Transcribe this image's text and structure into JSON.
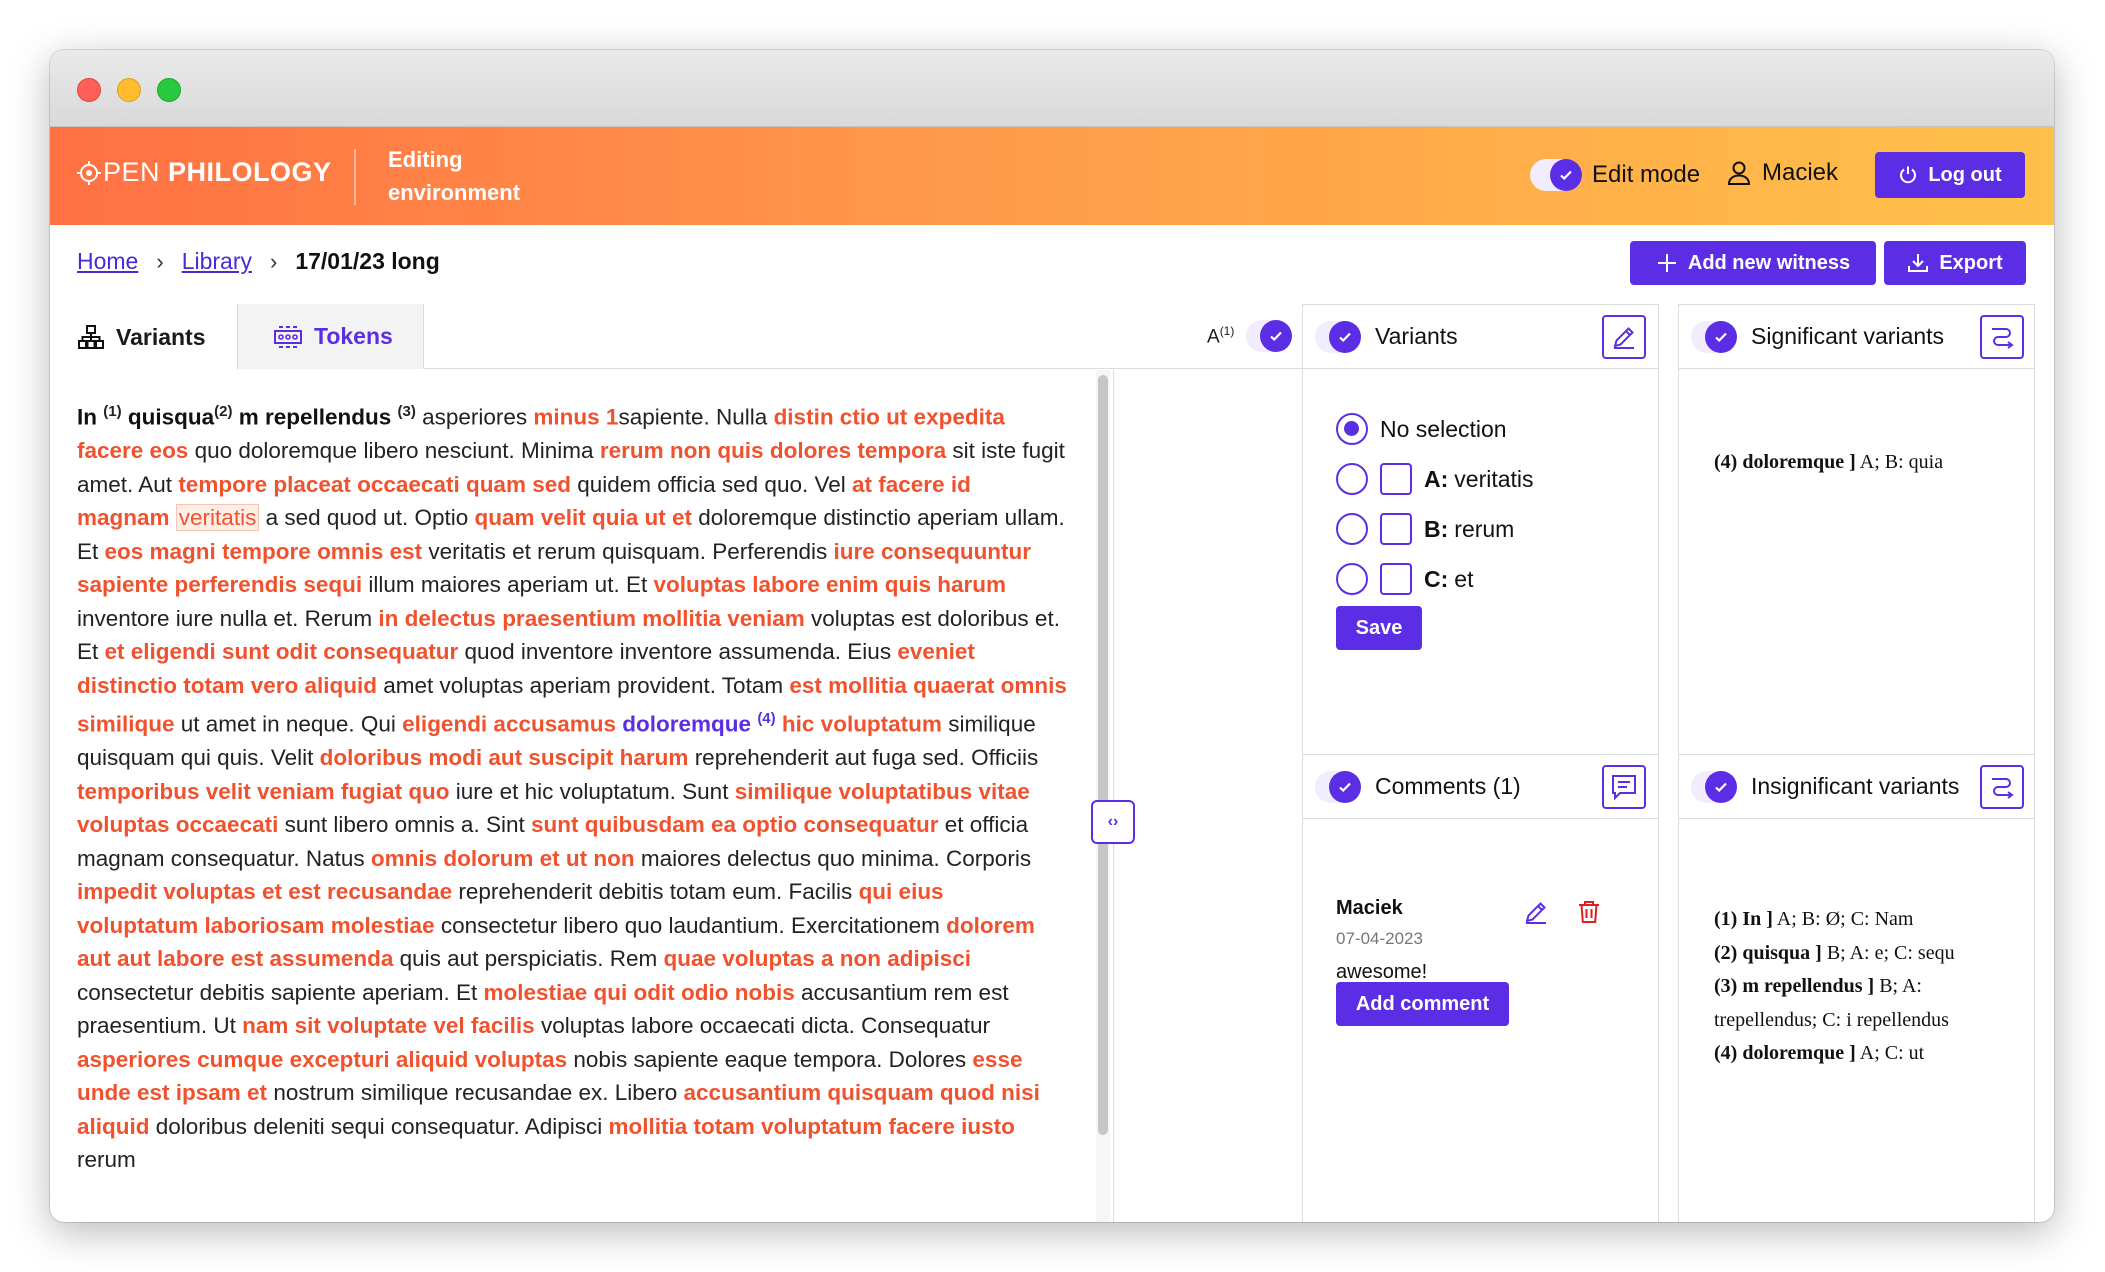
{
  "app": {
    "logo_left": "PEN",
    "logo_right": "PHILOLOGY",
    "environment_label": "Editing environment",
    "edit_mode_label": "Edit mode",
    "user_name": "Maciek",
    "logout_label": "Log out"
  },
  "breadcrumb": {
    "home": "Home",
    "library": "Library",
    "current": "17/01/23 long"
  },
  "actions": {
    "add_witness": "Add new witness",
    "export": "Export"
  },
  "tabs": {
    "variants": "Variants",
    "tokens": "Tokens",
    "witness_label": "A",
    "witness_sup": "(1)"
  },
  "text_segments": [
    {
      "t": "In ",
      "s": "b"
    },
    {
      "t": "(1)",
      "s": "supb"
    },
    {
      "t": " quisqua",
      "s": "b"
    },
    {
      "t": "(2)",
      "s": "supb"
    },
    {
      "t": " m repellendus ",
      "s": "b"
    },
    {
      "t": "(3)",
      "s": "supb"
    },
    {
      "t": " asperiores "
    },
    {
      "t": "minus 1",
      "s": "v"
    },
    {
      "t": "sapiente. Nulla "
    },
    {
      "t": "distin ctio ut expedita facere eos",
      "s": "v"
    },
    {
      "t": " quo doloremque libero nesciunt. Minima "
    },
    {
      "t": "rerum non quis dolores tempora",
      "s": "v"
    },
    {
      "t": " sit iste fugit amet. Aut "
    },
    {
      "t": "tempore placeat occaecati quam sed",
      "s": "v"
    },
    {
      "t": " quidem officia sed quo. Vel "
    },
    {
      "t": "at facere id magnam",
      "s": "v"
    },
    {
      "t": " "
    },
    {
      "t": "veritatis",
      "s": "hl"
    },
    {
      "t": " a sed quod ut. Optio "
    },
    {
      "t": "quam velit quia ut et",
      "s": "v"
    },
    {
      "t": " doloremque distinctio aperiam ullam. Et "
    },
    {
      "t": "eos magni tempore omnis est",
      "s": "v"
    },
    {
      "t": " veritatis et rerum quisquam. Perferendis "
    },
    {
      "t": "iure consequuntur sapiente perferendis sequi",
      "s": "v"
    },
    {
      "t": " illum maiores aperiam ut. Et "
    },
    {
      "t": "voluptas labore enim quis harum",
      "s": "v"
    },
    {
      "t": " inventore iure nulla et. Rerum "
    },
    {
      "t": "in delectus praesentium mollitia veniam",
      "s": "v"
    },
    {
      "t": " voluptas est doloribus et. Et "
    },
    {
      "t": "et eligendi sunt odit consequatur",
      "s": "v"
    },
    {
      "t": " quod inventore inventore assumenda. Eius "
    },
    {
      "t": "eveniet distinctio totam vero aliquid",
      "s": "v"
    },
    {
      "t": " amet voluptas aperiam provident. Totam "
    },
    {
      "t": "est mollitia quaerat omnis similique",
      "s": "v"
    },
    {
      "t": " ut amet in neque. Qui "
    },
    {
      "t": "eligendi accusamus",
      "s": "v"
    },
    {
      "t": " "
    },
    {
      "t": "doloremque",
      "s": "sel"
    },
    {
      "t": " "
    },
    {
      "t": "(4)",
      "s": "supsel"
    },
    {
      "t": " "
    },
    {
      "t": "hic voluptatum",
      "s": "v"
    },
    {
      "t": " similique quisquam qui quis. Velit "
    },
    {
      "t": "doloribus modi aut suscipit harum",
      "s": "v"
    },
    {
      "t": " reprehenderit aut fuga sed. Officiis "
    },
    {
      "t": "temporibus velit veniam fugiat quo",
      "s": "v"
    },
    {
      "t": " iure et hic voluptatum. Sunt "
    },
    {
      "t": "similique voluptatibus vitae voluptas occaecati",
      "s": "v"
    },
    {
      "t": " sunt libero omnis a. Sint "
    },
    {
      "t": "sunt quibusdam ea optio consequatur",
      "s": "v"
    },
    {
      "t": " et officia magnam consequatur. Natus "
    },
    {
      "t": "omnis dolorum et ut non",
      "s": "v"
    },
    {
      "t": " maiores delectus quo minima. Corporis "
    },
    {
      "t": "impedit voluptas et est recusandae",
      "s": "v"
    },
    {
      "t": " reprehenderit debitis totam eum. Facilis "
    },
    {
      "t": "qui eius voluptatum laboriosam molestiae",
      "s": "v"
    },
    {
      "t": " consectetur libero quo laudantium. Exercitationem "
    },
    {
      "t": "dolorem aut aut labore est assumenda",
      "s": "v"
    },
    {
      "t": " quis aut perspiciatis. Rem "
    },
    {
      "t": "quae voluptas a non adipisci",
      "s": "v"
    },
    {
      "t": " consectetur debitis sapiente aperiam. Et "
    },
    {
      "t": "molestiae qui odit odio nobis",
      "s": "v"
    },
    {
      "t": " accusantium rem est praesentium. Ut "
    },
    {
      "t": "nam sit voluptate vel facilis",
      "s": "v"
    },
    {
      "t": " voluptas labore occaecati dicta. Consequatur "
    },
    {
      "t": "asperiores cumque excepturi aliquid voluptas",
      "s": "v"
    },
    {
      "t": " nobis sapiente eaque tempora. Dolores "
    },
    {
      "t": "esse unde est ipsam et",
      "s": "v"
    },
    {
      "t": " nostrum similique recusandae ex. Libero "
    },
    {
      "t": "accusantium quisquam quod nisi aliquid",
      "s": "v"
    },
    {
      "t": " doloribus deleniti sequi consequatur. Adipisci "
    },
    {
      "t": "mollitia totam voluptatum facere iusto",
      "s": "v"
    },
    {
      "t": " rerum"
    }
  ],
  "variants_panel": {
    "title": "Variants",
    "no_selection": "No selection",
    "options": [
      {
        "witness": "A:",
        "reading": "veritatis"
      },
      {
        "witness": "B:",
        "reading": "rerum"
      },
      {
        "witness": "C:",
        "reading": "et"
      }
    ],
    "save_label": "Save"
  },
  "comments_panel": {
    "title": "Comments (1)",
    "comment": {
      "author": "Maciek",
      "date": "07-04-2023",
      "body": "awesome!"
    },
    "add_label": "Add comment"
  },
  "significant_panel": {
    "title": "Significant variants",
    "entries": [
      {
        "lemma": "(4) doloremque ]",
        "readings": "A; B: quia"
      }
    ]
  },
  "insignificant_panel": {
    "title": "Insignificant variants",
    "entries": [
      {
        "lemma": "(1) In ]",
        "readings": "A; B: Ø; C: Nam"
      },
      {
        "lemma": "(2) quisqua ]",
        "readings": "B; A: e; C: sequ"
      },
      {
        "lemma": "(3) m repellendus ]",
        "readings": "B; A: trepellendus; C: i repellendus"
      },
      {
        "lemma": "(4) doloremque ]",
        "readings": "A; C: ut"
      }
    ]
  },
  "colors": {
    "accent": "#5b2ee6",
    "variant_text": "#f1522e",
    "header_gradient_start": "#ff7043",
    "header_gradient_end": "#ffc14a"
  }
}
